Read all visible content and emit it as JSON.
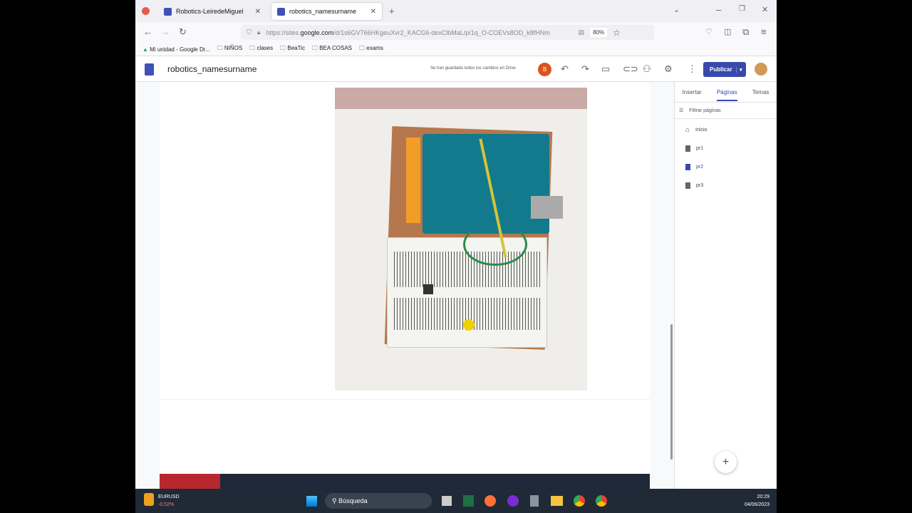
{
  "browser": {
    "tabs": [
      {
        "label": "Robotics-LeiredeMiguel",
        "active": false
      },
      {
        "label": "robotics_namesurname",
        "active": true
      }
    ],
    "url_prefix": "https://sites.",
    "url_domain": "google.com",
    "url_rest": "/d/1s6GV766HKgeuXvr2_KACG6-dexClbMaL/p/1q_O-COEVs8OD_k8fHNm",
    "zoom": "80%",
    "bookmarks": [
      "Mi unidad - Google Dr...",
      "NIÑOS",
      "clases",
      "BeaTic",
      "BEA COSAS",
      "exams"
    ]
  },
  "sites": {
    "title": "robotics_namesurname",
    "save_status": "Se han guardado todos los cambios en Drive",
    "user_initial": "B",
    "publish_label": "Publicar",
    "accent": "#3949ab",
    "panel": {
      "tabs": [
        "Insertar",
        "Páginas",
        "Temas"
      ],
      "active_tab": "Páginas",
      "filter_placeholder": "Filtrar páginas",
      "pages": [
        {
          "label": "Inicio",
          "icon": "home-icon"
        },
        {
          "label": "pr1",
          "icon": "page-icon"
        },
        {
          "label": "pr2",
          "icon": "page-icon",
          "selected": true
        },
        {
          "label": "pr3",
          "icon": "page-icon"
        }
      ]
    },
    "add_button": "+"
  },
  "taskbar": {
    "ticker": "EURUSD",
    "change": "-0,52%",
    "search": "Búsqueda",
    "time": "20:29",
    "date": "04/06/2023"
  }
}
